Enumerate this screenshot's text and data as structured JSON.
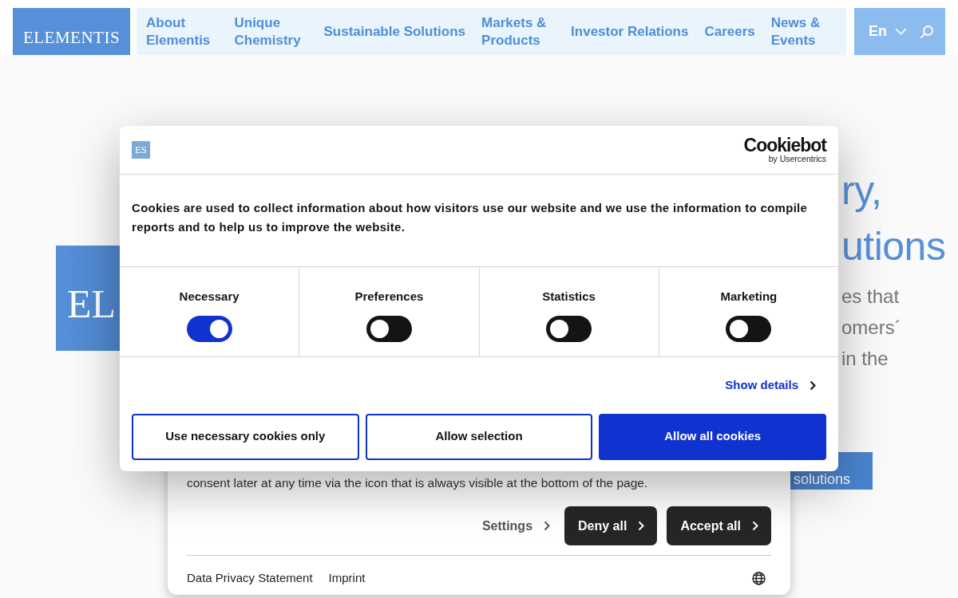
{
  "header": {
    "logo": "ELEMENTIS",
    "nav": [
      {
        "label": "About Elementis"
      },
      {
        "label": "Unique Chemistry"
      },
      {
        "label": "Sustainable Solutions"
      },
      {
        "label": "Markets & Products"
      },
      {
        "label": "Investor Relations"
      },
      {
        "label": "Careers"
      },
      {
        "label": "News & Events"
      }
    ],
    "language": "En"
  },
  "hero": {
    "logo_text": "EL",
    "title_lines": [
      "ry,",
      "utions"
    ],
    "subtitle_lines": [
      "es that",
      "omers´",
      "in the"
    ],
    "button": "solutions"
  },
  "consent_banner": {
    "text": "consent later at any time via the icon that is always visible at the bottom of the page.",
    "settings": "Settings",
    "deny": "Deny all",
    "accept": "Accept all",
    "links": [
      "Data Privacy Statement",
      "Imprint"
    ]
  },
  "cookie_dialog": {
    "logo": "ES",
    "brand": "Cookiebot",
    "brand_sub": "by Usercentrics",
    "text": "Cookies are used to collect information about how visitors use our website and we use the information to compile reports and to help us to improve the website.",
    "categories": [
      {
        "label": "Necessary",
        "checked": true
      },
      {
        "label": "Preferences",
        "checked": false
      },
      {
        "label": "Statistics",
        "checked": false
      },
      {
        "label": "Marketing",
        "checked": false
      }
    ],
    "show_details": "Show details",
    "buttons": [
      {
        "label": "Use necessary cookies only",
        "kind": "outline"
      },
      {
        "label": "Allow selection",
        "kind": "outline"
      },
      {
        "label": "Allow all cookies",
        "kind": "primary"
      }
    ]
  }
}
